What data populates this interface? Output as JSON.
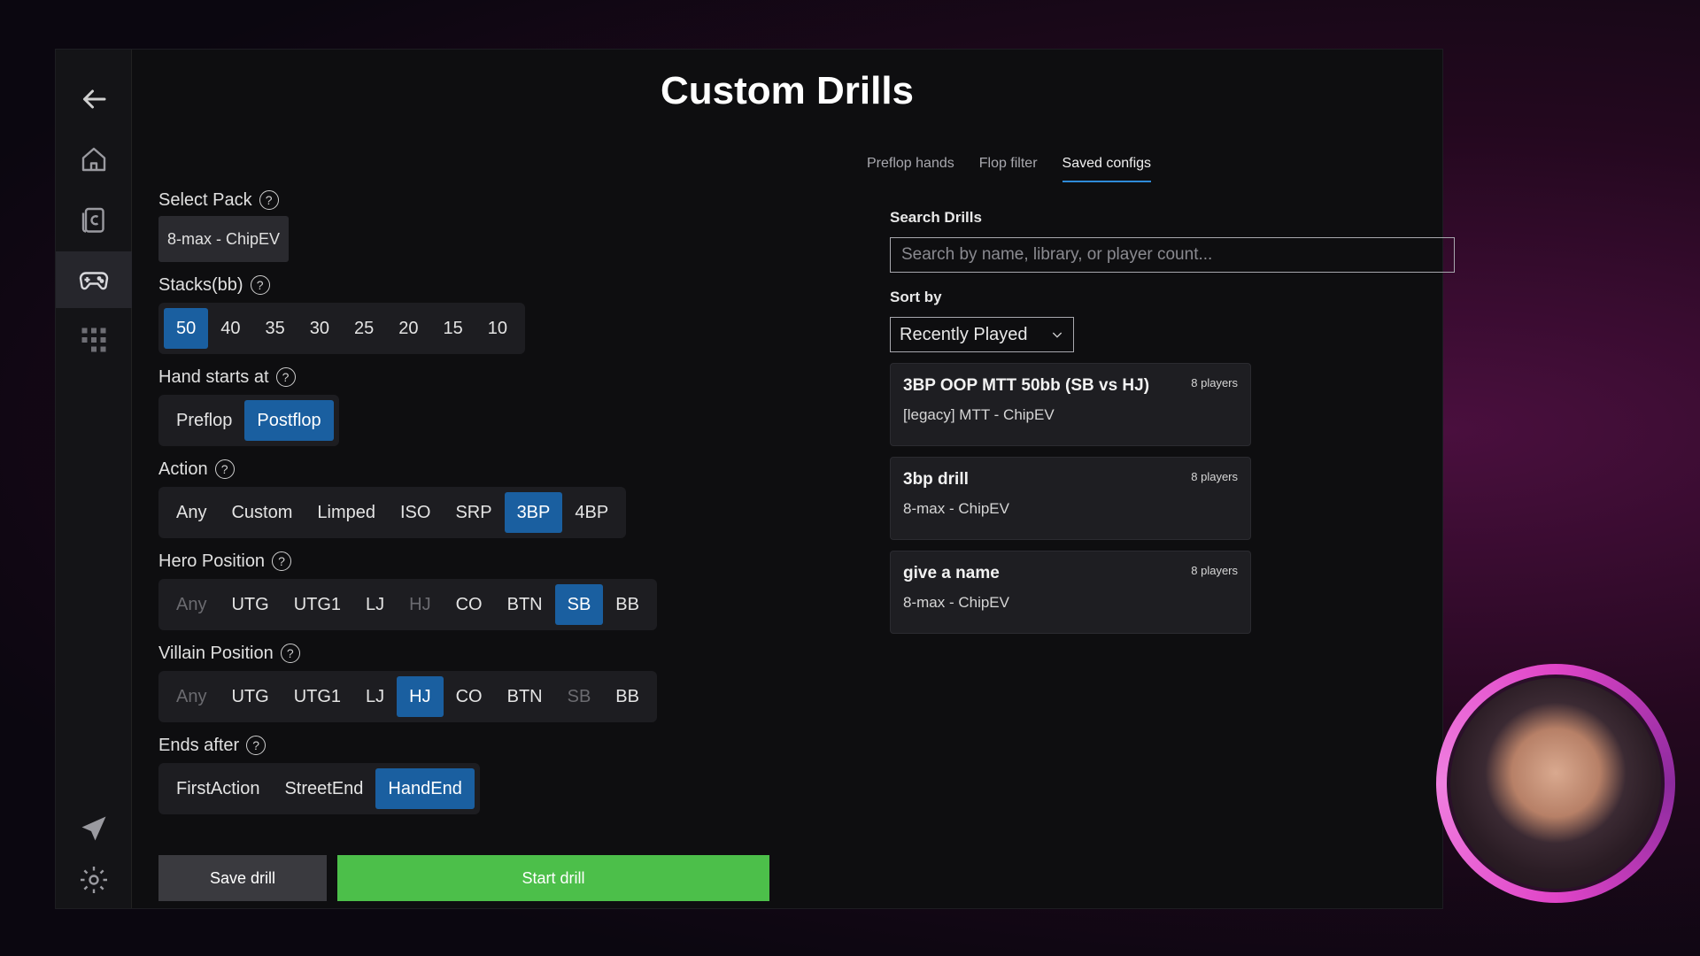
{
  "page": {
    "title": "Custom Drills"
  },
  "sidebar": {
    "items": [
      {
        "icon": "back-arrow-icon"
      },
      {
        "icon": "home-icon"
      },
      {
        "icon": "cards-icon"
      },
      {
        "icon": "gamepad-icon",
        "active": true
      },
      {
        "icon": "grid-icon"
      },
      {
        "icon": "send-icon"
      },
      {
        "icon": "settings-icon"
      }
    ]
  },
  "pack": {
    "label": "Select Pack",
    "value": "8-max - ChipEV"
  },
  "stacks": {
    "label": "Stacks(bb)",
    "options": [
      "50",
      "40",
      "35",
      "30",
      "25",
      "20",
      "15",
      "10"
    ],
    "selected": "50"
  },
  "hand_starts": {
    "label": "Hand starts at",
    "options": [
      "Preflop",
      "Postflop"
    ],
    "selected": "Postflop"
  },
  "action": {
    "label": "Action",
    "options": [
      "Any",
      "Custom",
      "Limped",
      "ISO",
      "SRP",
      "3BP",
      "4BP"
    ],
    "selected": "3BP"
  },
  "hero": {
    "label": "Hero Position",
    "options": [
      "Any",
      "UTG",
      "UTG1",
      "LJ",
      "HJ",
      "CO",
      "BTN",
      "SB",
      "BB"
    ],
    "selected": "SB",
    "disabled": [
      "Any",
      "HJ"
    ]
  },
  "villain": {
    "label": "Villain Position",
    "options": [
      "Any",
      "UTG",
      "UTG1",
      "LJ",
      "HJ",
      "CO",
      "BTN",
      "SB",
      "BB"
    ],
    "selected": "HJ",
    "disabled": [
      "Any",
      "SB"
    ]
  },
  "ends": {
    "label": "Ends after",
    "options": [
      "FirstAction",
      "StreetEnd",
      "HandEnd"
    ],
    "selected": "HandEnd"
  },
  "help_glyph": "?",
  "buttons": {
    "save": "Save drill",
    "start": "Start drill"
  },
  "tabs": {
    "preflop": "Preflop hands",
    "flop": "Flop filter",
    "saved": "Saved configs"
  },
  "search": {
    "label": "Search Drills",
    "placeholder": "Search by name, library, or player count..."
  },
  "sort": {
    "label": "Sort by",
    "value": "Recently Played"
  },
  "drills": [
    {
      "title": "3BP OOP MTT 50bb (SB vs HJ)",
      "library": "[legacy] MTT - ChipEV",
      "players": "8 players"
    },
    {
      "title": "3bp drill",
      "library": "8-max - ChipEV",
      "players": "8 players"
    },
    {
      "title": "give a name",
      "library": "8-max - ChipEV",
      "players": "8 players"
    }
  ],
  "colors": {
    "selected": "#1a5fa0",
    "start": "#4cbf4a",
    "tab_accent": "#2f8bd8"
  }
}
